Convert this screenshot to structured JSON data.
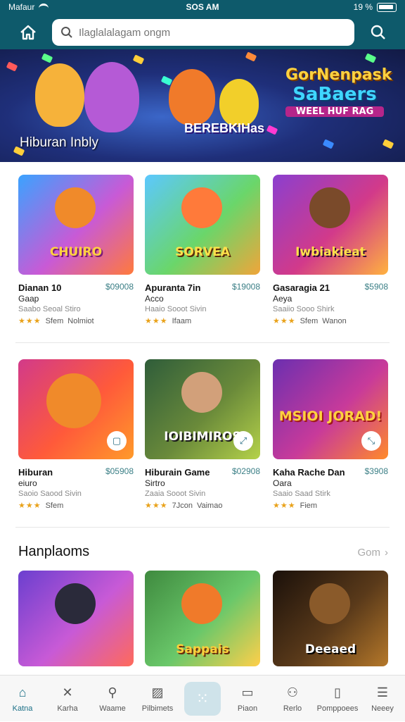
{
  "status_bar": {
    "carrier": "Mafaur",
    "time": "SOS AM",
    "battery": "19 %"
  },
  "search": {
    "placeholder": "Ilaglalalagam ongm"
  },
  "hero": {
    "title_line1": "GorNenpask",
    "title_line2": "SaBaers",
    "title_line3": "WEEL HUF RAG",
    "mid_text": "BEREBKIHas",
    "caption": "Hiburan Inbly"
  },
  "row1": [
    {
      "art_text": "CHUIRO",
      "name": "Dianan 10",
      "price": "$09008",
      "sub": "Gaap",
      "meta": "Saabo  Seoal Stiro",
      "stars": "★★★",
      "rating": "Sfem",
      "extra": "Nolmiot",
      "colors": [
        "#3aa3ff",
        "#ff7a3c"
      ]
    },
    {
      "art_text": "SORVEA",
      "name": "Apuranta 7in",
      "price": "$19008",
      "sub": "Acco",
      "meta": "Haaio  Sooot Sivin",
      "stars": "★★★",
      "rating": "Ifaam",
      "extra": "",
      "colors": [
        "#5cc8ff",
        "#f0a53a"
      ]
    },
    {
      "art_text": "Iwbiakieat",
      "name": "Gasaragia 21",
      "price": "$5908",
      "sub": "Aeya",
      "meta": "Saaiio  Sooo Shirk",
      "stars": "★★★",
      "rating": "Sfem",
      "extra": "Wanon",
      "colors": [
        "#8b3fcf",
        "#ffb23f"
      ]
    }
  ],
  "row2": [
    {
      "art_text": "",
      "name": "Hiburan",
      "price": "$05908",
      "sub": "eiuro",
      "meta": "Saoio  Saood Sivin",
      "stars": "★★★",
      "rating": "Sfem",
      "extra": "",
      "colors": [
        "#d23a8a",
        "#ff9a2a"
      ],
      "fbtn": "▢"
    },
    {
      "art_text": "IOIBIMIROS",
      "name": "Hiburain Game",
      "price": "$02908",
      "sub": "Sirtro",
      "meta": "Zaaia  Sooot Sivin",
      "stars": "★★★",
      "rating": "7Jcon",
      "extra": "Vaimao",
      "colors": [
        "#2f5d3a",
        "#b5d24a"
      ],
      "fbtn": "⤢"
    },
    {
      "art_text": "MSIOI JORAD!",
      "name": "Kaha Rache Dan",
      "price": "$3908",
      "sub": "Oara",
      "meta": "Saaio  Saad Stirk",
      "stars": "★★★",
      "rating": "Fiem",
      "extra": "",
      "colors": [
        "#6b2fb0",
        "#ff8a2a"
      ],
      "fbtn": "⤡"
    }
  ],
  "section": {
    "title": "Hanplaoms",
    "see_all": "Gom"
  },
  "row3": [
    {
      "art_text": "",
      "colors": [
        "#6b3fcf",
        "#ff6a5a"
      ]
    },
    {
      "art_text": "Sappais",
      "colors": [
        "#3f8a3f",
        "#ffcf4a"
      ]
    },
    {
      "art_text": "Deeaed",
      "colors": [
        "#2a1a10",
        "#b5782a"
      ]
    }
  ],
  "bottom_nav": [
    {
      "label": "Katna",
      "icon": "home-icon",
      "glyph": "⌂",
      "active": true
    },
    {
      "label": "Karha",
      "icon": "tools-icon",
      "glyph": "✕",
      "active": false
    },
    {
      "label": "Waame",
      "icon": "search-person-icon",
      "glyph": "⚲",
      "active": false
    },
    {
      "label": "Pilbimets",
      "icon": "image-icon",
      "glyph": "▨",
      "active": false
    },
    {
      "label": "",
      "icon": "grid-icon",
      "glyph": "⁙",
      "active": false,
      "center": true
    },
    {
      "label": "Piaon",
      "icon": "message-icon",
      "glyph": "▭",
      "active": false
    },
    {
      "label": "Rerlo",
      "icon": "profile-icon",
      "glyph": "⚇",
      "active": false
    },
    {
      "label": "Pomppoees",
      "icon": "device-icon",
      "glyph": "▯",
      "active": false
    },
    {
      "label": "Neeey",
      "icon": "menu-icon",
      "glyph": "☰",
      "active": false
    }
  ],
  "colors": {
    "header": "#0e5a6b",
    "accent": "#1a6f86",
    "star": "#e9a21a"
  }
}
